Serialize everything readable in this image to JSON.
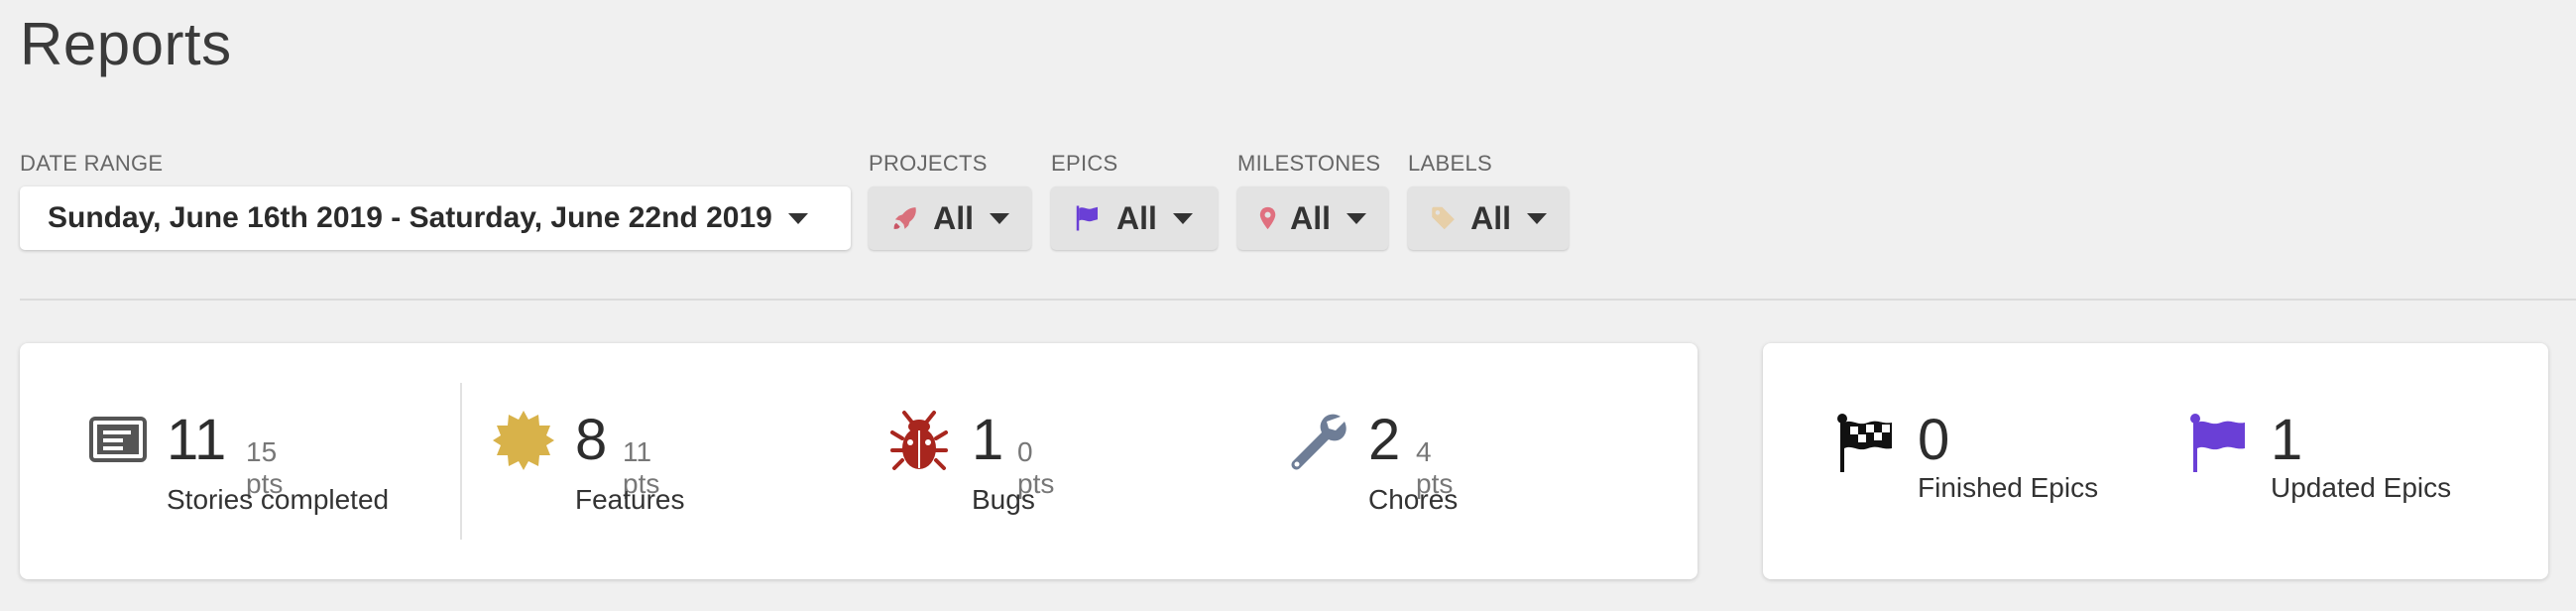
{
  "page": {
    "title": "Reports"
  },
  "filters": {
    "date_range": {
      "label": "DATE RANGE",
      "value": "Sunday, June 16th 2019 - Saturday, June 22nd 2019"
    },
    "projects": {
      "label": "PROJECTS",
      "value": "All",
      "icon": "rocket-icon"
    },
    "epics": {
      "label": "EPICS",
      "value": "All",
      "icon": "flag-icon"
    },
    "milestones": {
      "label": "MILESTONES",
      "value": "All",
      "icon": "map-pin-icon"
    },
    "labels": {
      "label": "LABELS",
      "value": "All",
      "icon": "tag-icon"
    }
  },
  "stats": {
    "stories": {
      "count": "11",
      "pts": "15 pts",
      "label": "Stories completed",
      "icon": "story-card-icon"
    },
    "features": {
      "count": "8",
      "pts": "11 pts",
      "label": "Features",
      "icon": "feature-badge-icon"
    },
    "bugs": {
      "count": "1",
      "pts": "0 pts",
      "label": "Bugs",
      "icon": "bug-icon"
    },
    "chores": {
      "count": "2",
      "pts": "4 pts",
      "label": "Chores",
      "icon": "wrench-icon"
    }
  },
  "epics": {
    "finished": {
      "count": "0",
      "label": "Finished Epics",
      "icon": "checkered-flag-icon"
    },
    "updated": {
      "count": "1",
      "label": "Updated Epics",
      "icon": "purple-flag-icon"
    }
  },
  "colors": {
    "background": "#f0f0f0",
    "rocket": "#d9707b",
    "epic_flag": "#6a3fd6",
    "pin": "#e0707f",
    "tag": "#e7cfa8",
    "feature": "#d8b24a",
    "bug": "#a8261e",
    "wrench": "#6e7d96"
  }
}
